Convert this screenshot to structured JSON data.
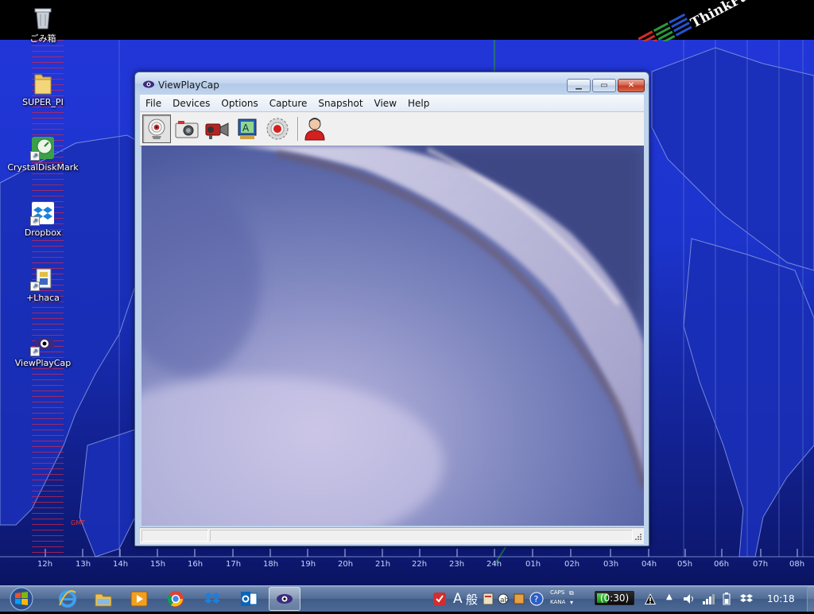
{
  "desktop": {
    "icons": [
      {
        "label": "ごみ箱",
        "icon": "recycle-bin-icon"
      },
      {
        "label": "SUPER_PI",
        "icon": "folder-icon"
      },
      {
        "label": "CrystalDiskMark",
        "icon": "crystaldiskmark-icon"
      },
      {
        "label": "Dropbox",
        "icon": "dropbox-icon"
      },
      {
        "label": "+Lhaca",
        "icon": "lhaca-icon"
      },
      {
        "label": "ViewPlayCap",
        "icon": "viewplaycap-icon"
      }
    ],
    "gmt_label": "GMT",
    "timeline": [
      "12h",
      "13h",
      "14h",
      "15h",
      "16h",
      "17h",
      "18h",
      "19h",
      "20h",
      "21h",
      "22h",
      "23h",
      "24h",
      "01h",
      "02h",
      "03h",
      "04h",
      "05h",
      "06h",
      "07h",
      "08h"
    ],
    "logo_text": "ThinkPad",
    "colors": {
      "background": "#1c34cc",
      "stripe": "#dc2846"
    }
  },
  "window": {
    "title": "ViewPlayCap",
    "menu": [
      "File",
      "Devices",
      "Options",
      "Capture",
      "Snapshot",
      "View",
      "Help"
    ],
    "toolbar": [
      {
        "icon": "webcam-preview-icon",
        "active": true
      },
      {
        "icon": "camera-snapshot-icon",
        "active": false
      },
      {
        "icon": "video-camera-icon",
        "active": false
      },
      {
        "icon": "video-settings-icon",
        "active": false
      },
      {
        "icon": "record-icon",
        "active": false
      },
      {
        "icon": "user-icon",
        "active": false
      }
    ],
    "status": [
      "",
      ""
    ]
  },
  "taskbar": {
    "apps": [
      "start-orb-icon",
      "internet-explorer-icon",
      "file-explorer-icon",
      "media-player-icon",
      "chrome-icon",
      "dropbox-icon",
      "outlook-icon",
      "viewplaycap-icon"
    ],
    "active_app": "viewplaycap-icon",
    "ime_mode": "A",
    "ime_label": "般",
    "caps_label": "CAPS",
    "kana_label": "KANA",
    "battery_text": "(0:30)",
    "battery_level": 0.3,
    "clock": "10:18"
  }
}
